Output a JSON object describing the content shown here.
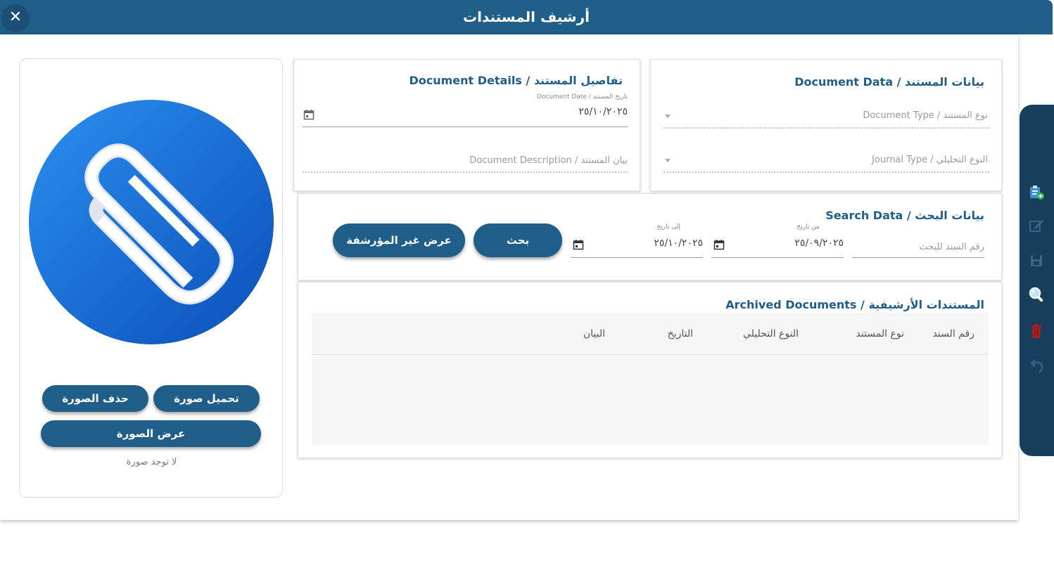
{
  "window": {
    "title": "أرشيف المستندات",
    "close_glyph": "✕"
  },
  "image_panel": {
    "icon": "paperclip-icon",
    "upload_label": "تحميل صورة",
    "delete_label": "حذف الصورة",
    "view_label": "عرض الصورة",
    "no_image_text": "لا توجد صورة"
  },
  "document_data": {
    "title": "بيانات المستند / Document Data",
    "document_type_placeholder": "نوع المستند / Document Type",
    "journal_type_placeholder": "النوع التحليلي / Journal Type"
  },
  "document_details": {
    "title": "تفاصيل المستند / Document Details",
    "date_label": "تاريخ المستند / Document Date",
    "date_value": "٢٥/١٠/٢٠٢٥",
    "description_placeholder": "بيان المستند / Document Description"
  },
  "search_data": {
    "title": "بيانات البحث / Search Data",
    "doc_number_placeholder": "رقم السند للبحث",
    "from_date_label": "من تاريخ",
    "from_date_value": "٢٥/٠٩/٢٠٢٥",
    "to_date_label": "إلى تاريخ",
    "to_date_value": "٢٥/١٠/٢٠٢٥",
    "search_label": "بحث",
    "show_unarchived_label": "عرض غير المؤرشفة"
  },
  "archived": {
    "title": "المستندات الأرشيفية / Archived Documents",
    "columns": [
      "رقم السند",
      "نوع المستند",
      "النوع التحليلي",
      "التاريخ",
      "البيان"
    ]
  },
  "toolbar": {
    "icons": [
      "add-document-icon",
      "edit-icon",
      "save-icon",
      "search-icon",
      "delete-icon",
      "undo-icon"
    ]
  },
  "colors": {
    "primary": "#1f5e89",
    "toolbar": "#173f5c",
    "delete": "#b01d1d"
  }
}
